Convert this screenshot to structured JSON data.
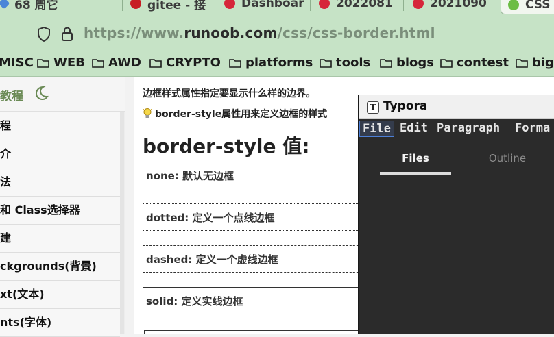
{
  "browser": {
    "tabs": [
      {
        "label": "68 周它"
      },
      {
        "label": "gitee - 接"
      },
      {
        "label": "Dashboar"
      },
      {
        "label": "2022081"
      },
      {
        "label": "2021090"
      },
      {
        "label": "CSS"
      }
    ],
    "url_prefix": "https://www.",
    "url_host": "runoob.com",
    "url_path": "/css/css-border.html",
    "bookmarks": [
      "MISC",
      "WEB",
      "AWD",
      "CRYPTO",
      "platforms",
      "tools",
      "blogs",
      "contest",
      "bigc"
    ]
  },
  "sidebar": {
    "title": "教程",
    "items": [
      "程",
      "介",
      "法",
      "和 Class选择器",
      "建",
      "ckgrounds(背景)",
      "xt(文本)",
      "nts(字体)"
    ]
  },
  "main": {
    "intro": "边框样式属性指定要显示什么样的边界。",
    "tip": "border-style属性用来定义边框的样式",
    "heading": "border-style 值:",
    "examples": {
      "none": "none: 默认无边框",
      "dotted": "dotted: 定义一个点线边框",
      "dashed": "dashed: 定义一个虚线边框",
      "solid": "solid: 定义实线边框"
    }
  },
  "typora": {
    "title": "Typora",
    "logo_letter": "T",
    "menu": [
      "File",
      "Edit",
      "Paragraph",
      "Forma"
    ],
    "tabs": [
      "Files",
      "Outline"
    ],
    "active_tab": "Files"
  },
  "colors": {
    "browser_chrome": "#c6e3c6",
    "typora_bg": "#2b2b2b",
    "menu_highlight": "#4d7fd6"
  }
}
